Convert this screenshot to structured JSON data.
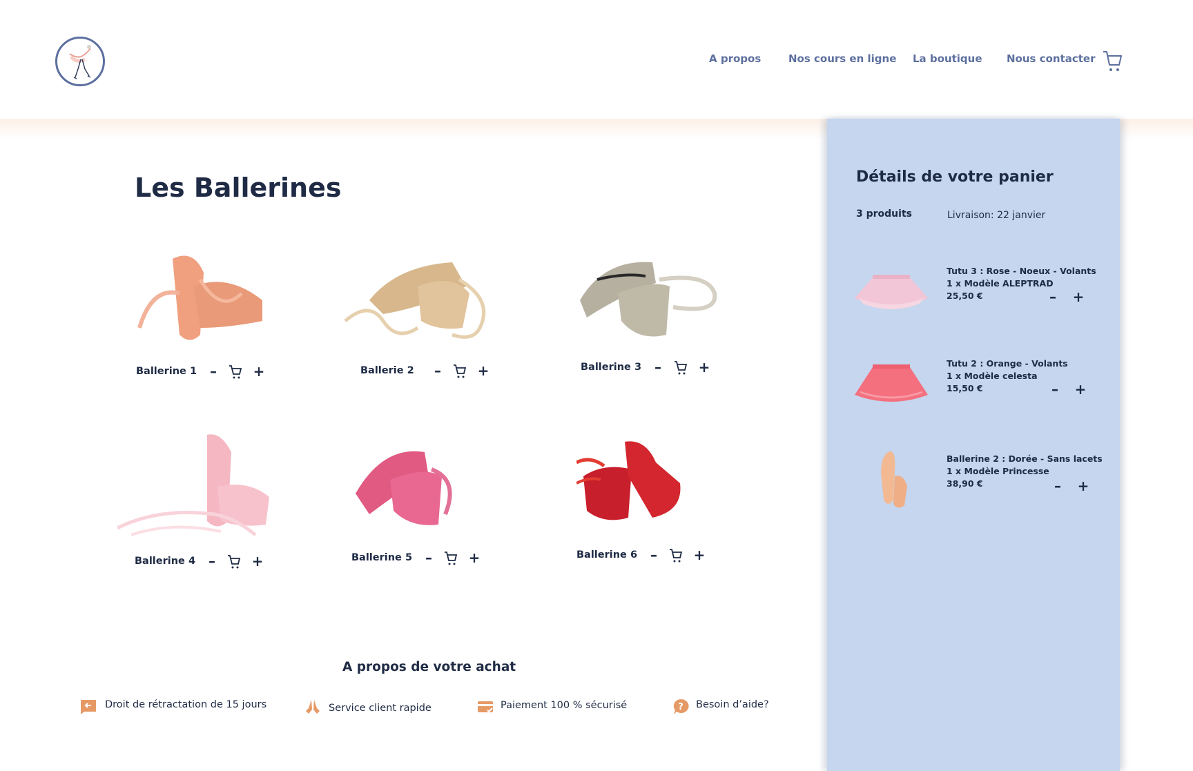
{
  "header": {
    "nav": [
      {
        "label": "A propos"
      },
      {
        "label": "Nos cours en ligne"
      },
      {
        "label": "La boutique"
      },
      {
        "label": "Nous contacter"
      }
    ],
    "cart_icon": "cart-icon",
    "logo_icon": "ballerina-logo"
  },
  "main": {
    "title": "Les Ballerines",
    "products": [
      {
        "name": "Ballerine 1",
        "color": "#eea384"
      },
      {
        "name": "Ballerie 2",
        "color": "#d9bb90"
      },
      {
        "name": "Ballerine 3",
        "color": "#b9b3a4"
      },
      {
        "name": "Ballerine 4",
        "color": "#f4b9c4"
      },
      {
        "name": "Ballerine 5",
        "color": "#e0577e"
      },
      {
        "name": "Ballerine 6",
        "color": "#cf2230"
      }
    ],
    "controls": {
      "minus": "–",
      "plus": "+"
    }
  },
  "about": {
    "title": "A propos de votre achat",
    "features": [
      {
        "label": "Droit de rétractation de 15 jours",
        "icon": "return-icon"
      },
      {
        "label": "Service client rapide",
        "icon": "hands-icon"
      },
      {
        "label": "Paiement 100 % sécurisé",
        "icon": "card-icon"
      },
      {
        "label": "Besoin d’aide?",
        "icon": "help-icon"
      }
    ],
    "accent_color": "#e59a66"
  },
  "cart": {
    "title": "Détails de votre panier",
    "count": "3 produits",
    "delivery": "Livraison: 22 janvier",
    "items": [
      {
        "title": "Tutu 3 : Rose - Noeux - Volants",
        "model": "1 x Modèle ALEPTRAD",
        "price": "25,50 €",
        "color": "#f2c6d6"
      },
      {
        "title": "Tutu 2 : Orange - Volants",
        "model": "1 x Modèle celesta",
        "price": "15,50 €",
        "color": "#f4707f"
      },
      {
        "title": "Ballerine 2 : Dorée - Sans lacets",
        "model": "1 x Modèle Princesse",
        "price": "38,90 €",
        "color": "#f2b993"
      }
    ],
    "panel_color": "#c5d6ee"
  }
}
